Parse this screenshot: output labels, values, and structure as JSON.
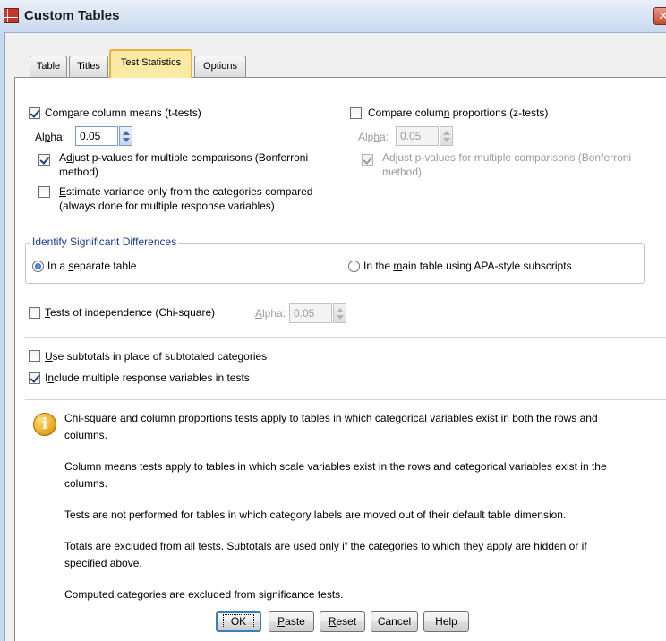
{
  "window": {
    "title": "Custom Tables",
    "close_label": "✕"
  },
  "tabs": [
    {
      "label": "Table",
      "active": false
    },
    {
      "label": "Titles",
      "active": false
    },
    {
      "label": "Test Statistics",
      "active": true
    },
    {
      "label": "Options",
      "active": false
    }
  ],
  "compare_means": {
    "label_pre": "Com",
    "label_ul": "p",
    "label_post": "are column means (t-tests)",
    "checked": true,
    "alpha_pre": "Al",
    "alpha_ul": "p",
    "alpha_post": "ha:",
    "alpha_value": "0.05",
    "adjust_pre": "A",
    "adjust_ul": "d",
    "adjust_post": "just p-values for multiple comparisons (Bonferroni",
    "adjust_line2": "method)",
    "adjust_checked": true,
    "estimate_ul": "E",
    "estimate_post": "stimate variance only from the categories compared",
    "estimate_line2": "(always done for multiple response variables)",
    "estimate_checked": false
  },
  "compare_props": {
    "label_pre": "Compare colum",
    "label_ul": "n",
    "label_post": " proportions (z-tests)",
    "checked": false,
    "alpha_pre": "Alp",
    "alpha_ul": "h",
    "alpha_post": "a:",
    "alpha_value": "0.05",
    "adjust_line1": "Adjust p-values for multiple comparisons (Bonferroni",
    "adjust_line2": "method)",
    "adjust_checked": true
  },
  "identify": {
    "legend": "Identify Significant Differences",
    "separate_pre": "In a ",
    "separate_ul": "s",
    "separate_post": "eparate table",
    "separate_checked": true,
    "main_pre": "In the ",
    "main_ul": "m",
    "main_post": "ain table using APA-style subscripts",
    "main_checked": false
  },
  "independence": {
    "label_ul": "T",
    "label_post": "ests of independence (Chi-square)",
    "checked": false,
    "alpha_ul": "A",
    "alpha_post": "lpha:",
    "alpha_value": "0.05"
  },
  "subtotals": {
    "label_ul": "U",
    "label_post": "se subtotals in place of subtotaled categories",
    "checked": false
  },
  "include_multi": {
    "label_pre": "I",
    "label_ul": "n",
    "label_post": "clude multiple response variables in tests",
    "checked": true
  },
  "info": {
    "p1_line1": "Chi-square and column proportions tests apply to tables in which categorical variables exist in both the rows and",
    "p1_line2": "columns.",
    "p2_line1": "Column means tests apply to tables in which scale variables exist in the rows and categorical variables exist in the",
    "p2_line2": "columns.",
    "p3": "Tests are not performed for tables in which category labels are moved out of their default table dimension.",
    "p4_line1": "Totals are excluded from all tests. Subtotals are used only if the categories to which they apply are hidden or if",
    "p4_line2": "specified above.",
    "p5": "Computed categories are excluded from significance tests."
  },
  "buttons": {
    "ok": "OK",
    "paste_ul": "P",
    "paste_post": "aste",
    "reset_ul": "R",
    "reset_post": "eset",
    "cancel": "Cancel",
    "help": "Help"
  }
}
